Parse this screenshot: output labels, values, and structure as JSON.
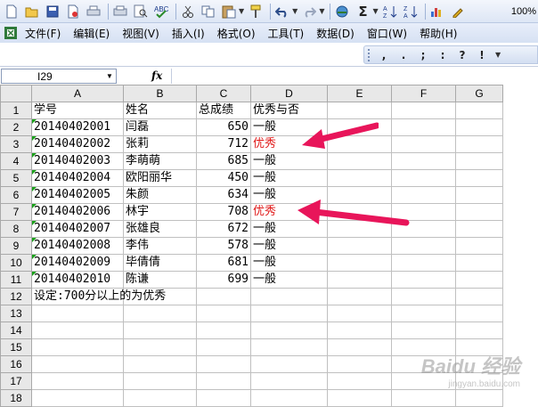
{
  "toolbar": {
    "buttons": [
      "new-icon",
      "open-icon",
      "save-icon",
      "permission-icon",
      "print-icon",
      "print-preview-icon",
      "spelling-icon",
      "cut-icon",
      "copy-icon",
      "paste-icon",
      "format-painter-icon",
      "undo-icon",
      "redo-icon",
      "hyperlink-icon",
      "autosum-icon",
      "sort-ascending-icon",
      "sort-descending-icon",
      "chart-wizard-icon",
      "drawing-icon"
    ],
    "zoom": "100%"
  },
  "menu": [
    "文件(F)",
    "编辑(E)",
    "视图(V)",
    "插入(I)",
    "格式(O)",
    "工具(T)",
    "数据(D)",
    "窗口(W)",
    "帮助(H)"
  ],
  "format_bar": [
    ",",
    ".",
    ";",
    ":",
    "?",
    "!"
  ],
  "formula_bar": {
    "name_box": "I29",
    "fx": "fx",
    "formula": ""
  },
  "columns": [
    "A",
    "B",
    "C",
    "D",
    "E",
    "F",
    "G"
  ],
  "rows": [
    {
      "n": "1",
      "a": "学号",
      "b": "姓名",
      "c": "总成绩",
      "d": "优秀与否"
    },
    {
      "n": "2",
      "a": "20140402001",
      "b": "闫磊",
      "c": "650",
      "d": "一般"
    },
    {
      "n": "3",
      "a": "20140402002",
      "b": "张莉",
      "c": "712",
      "d": "优秀"
    },
    {
      "n": "4",
      "a": "20140402003",
      "b": "李萌萌",
      "c": "685",
      "d": "一般"
    },
    {
      "n": "5",
      "a": "20140402004",
      "b": "欧阳丽华",
      "c": "450",
      "d": "一般"
    },
    {
      "n": "6",
      "a": "20140402005",
      "b": "朱颜",
      "c": "634",
      "d": "一般"
    },
    {
      "n": "7",
      "a": "20140402006",
      "b": "林宇",
      "c": "708",
      "d": "优秀"
    },
    {
      "n": "8",
      "a": "20140402007",
      "b": "张雄良",
      "c": "672",
      "d": "一般"
    },
    {
      "n": "9",
      "a": "20140402008",
      "b": "李伟",
      "c": "578",
      "d": "一般"
    },
    {
      "n": "10",
      "a": "20140402009",
      "b": "毕倩倩",
      "c": "681",
      "d": "一般"
    },
    {
      "n": "11",
      "a": "20140402010",
      "b": "陈谦",
      "c": "699",
      "d": "一般"
    },
    {
      "n": "12",
      "a": "设定:700分以上的为优秀",
      "b": "",
      "c": "",
      "d": ""
    },
    {
      "n": "13",
      "a": "",
      "b": "",
      "c": "",
      "d": ""
    },
    {
      "n": "14",
      "a": "",
      "b": "",
      "c": "",
      "d": ""
    },
    {
      "n": "15",
      "a": "",
      "b": "",
      "c": "",
      "d": ""
    },
    {
      "n": "16",
      "a": "",
      "b": "",
      "c": "",
      "d": ""
    },
    {
      "n": "17",
      "a": "",
      "b": "",
      "c": "",
      "d": ""
    },
    {
      "n": "18",
      "a": "",
      "b": "",
      "c": "",
      "d": ""
    }
  ],
  "highlight_color": "#e01a1a",
  "arrow_color": "#e8155a",
  "watermark": {
    "main": "Baidu 经验",
    "sub": "jingyan.baidu.com"
  }
}
